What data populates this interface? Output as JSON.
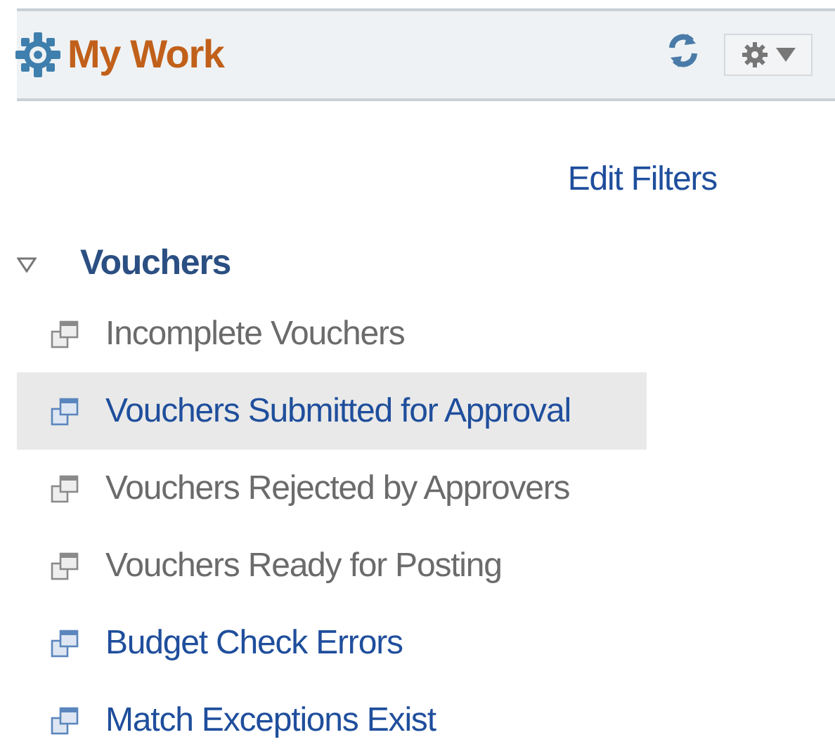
{
  "header": {
    "title": "My Work"
  },
  "edit_filters": "Edit Filters",
  "group": {
    "label": "Vouchers",
    "expanded": true,
    "items": [
      {
        "label": "Incomplete Vouchers",
        "active": false,
        "selected": false
      },
      {
        "label": "Vouchers Submitted for Approval",
        "active": true,
        "selected": true
      },
      {
        "label": "Vouchers Rejected by Approvers",
        "active": false,
        "selected": false
      },
      {
        "label": "Vouchers Ready for Posting",
        "active": false,
        "selected": false
      },
      {
        "label": "Budget Check Errors",
        "active": true,
        "selected": false
      },
      {
        "label": "Match Exceptions Exist",
        "active": true,
        "selected": false
      }
    ]
  }
}
